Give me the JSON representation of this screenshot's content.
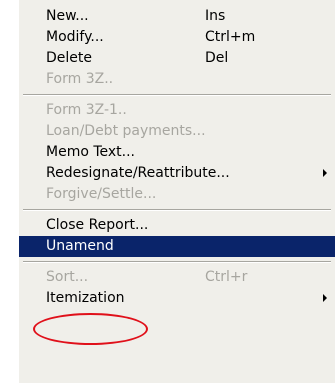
{
  "menu": {
    "items": [
      {
        "label": "New...",
        "shortcut": "Ins",
        "disabled": false
      },
      {
        "label": "Modify...",
        "shortcut": "Ctrl+m",
        "disabled": false
      },
      {
        "label": "Delete",
        "shortcut": "Del",
        "disabled": false
      },
      {
        "label": "Form 3Z..",
        "shortcut": "",
        "disabled": true
      },
      {
        "label": "Form 3Z-1..",
        "shortcut": "",
        "disabled": true
      },
      {
        "label": "Loan/Debt payments...",
        "shortcut": "",
        "disabled": true
      },
      {
        "label": "Memo Text...",
        "shortcut": "",
        "disabled": false
      },
      {
        "label": "Redesignate/Reattribute...",
        "shortcut": "",
        "disabled": false,
        "submenu": true
      },
      {
        "label": "Forgive/Settle...",
        "shortcut": "",
        "disabled": true
      },
      {
        "label": "Close Report...",
        "shortcut": "",
        "disabled": false
      },
      {
        "label": "Unamend",
        "shortcut": "",
        "disabled": false,
        "highlighted": true
      },
      {
        "label": "Sort...",
        "shortcut": "Ctrl+r",
        "disabled": true
      },
      {
        "label": "Itemization",
        "shortcut": "",
        "disabled": false,
        "submenu": true
      }
    ]
  },
  "colors": {
    "menu_background": "#f0efea",
    "highlight_background": "#0a246a",
    "highlight_text": "#ffffff",
    "disabled_text": "#a7a6a0",
    "annotation_ellipse": "#e0101a"
  }
}
